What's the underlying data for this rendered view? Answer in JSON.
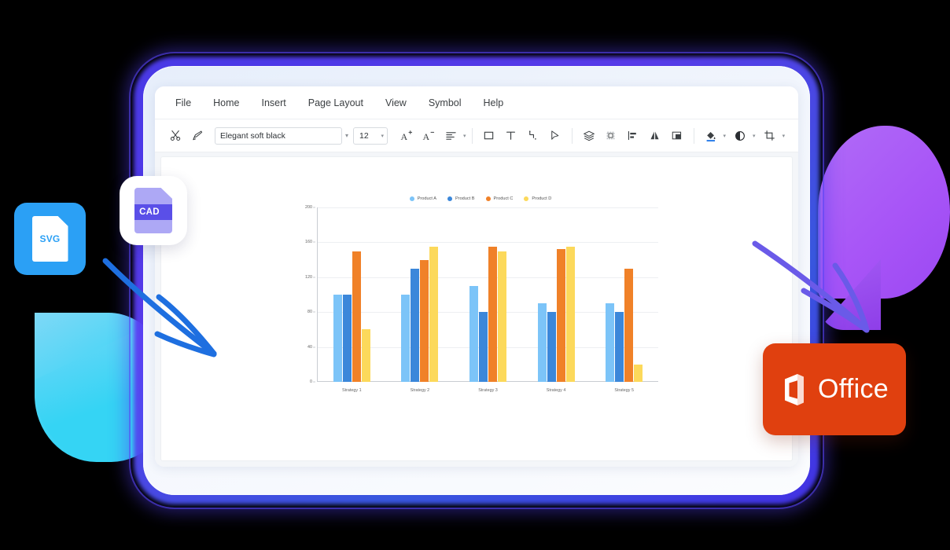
{
  "app": {
    "menu": [
      {
        "label": "File"
      },
      {
        "label": "Home"
      },
      {
        "label": "Insert"
      },
      {
        "label": "Page Layout"
      },
      {
        "label": "View"
      },
      {
        "label": "Symbol"
      },
      {
        "label": "Help"
      }
    ],
    "toolbar": {
      "cut_icon": "scissors-icon",
      "format_painter_icon": "format-painter-icon",
      "font_name": "Elegant soft black",
      "font_name_caret": "▾",
      "font_size": "12",
      "font_size_caret": "▾",
      "grow_font_icon": "A+",
      "shrink_font_icon": "A-",
      "align_icon": "align-left-icon",
      "align_caret": "▾",
      "shape_icon": "rectangle-icon",
      "text_icon": "text-tool-icon",
      "connector_icon": "connector-icon",
      "pointer_icon": "pointer-icon",
      "layers_icon": "layers-icon",
      "group_icon": "group-icon",
      "distribute_icon": "distribute-icon",
      "flip_icon": "flip-icon",
      "bring_front_icon": "bring-to-front-icon",
      "fill_icon": "fill-color-icon",
      "fill_caret": "▾",
      "line_color_icon": "line-color-icon",
      "line_caret": "▾",
      "crop_icon": "crop-icon",
      "crop_caret": "▾"
    }
  },
  "chart_data": {
    "type": "bar",
    "title": "",
    "xlabel": "",
    "ylabel": "",
    "categories": [
      "Strategy 1",
      "Strategy 2",
      "Strategy 3",
      "Strategy 4",
      "Strategy 5"
    ],
    "series": [
      {
        "name": "Product A",
        "color": "#7CC4F8",
        "values": [
          100,
          100,
          110,
          90,
          90
        ]
      },
      {
        "name": "Product B",
        "color": "#3B87DA",
        "values": [
          100,
          130,
          80,
          80,
          80
        ]
      },
      {
        "name": "Product C",
        "color": "#F08128",
        "values": [
          150,
          140,
          155,
          152,
          130
        ]
      },
      {
        "name": "Product D",
        "color": "#FCD95B",
        "values": [
          60,
          155,
          150,
          155,
          20
        ]
      }
    ],
    "ylim": [
      0,
      200
    ],
    "yticks": [
      0,
      40,
      80,
      120,
      160,
      200
    ],
    "grid": true,
    "legend_position": "top"
  },
  "badges": {
    "svg": {
      "label": "SVG",
      "color": "#2BA0F5"
    },
    "cad": {
      "label": "CAD",
      "doc_color": "#ADA8F5",
      "band_color": "#5A4FE8"
    },
    "office": {
      "label": "Office",
      "color": "#E0400F"
    }
  },
  "decor": {
    "arrow_left_color": "#1E6FE0",
    "arrow_right_color": "#6A5AE8",
    "blob_cyan_color": "#3ED5F5",
    "blob_purple_color": "#A855F7",
    "glow_color": "#4C3CF0"
  }
}
